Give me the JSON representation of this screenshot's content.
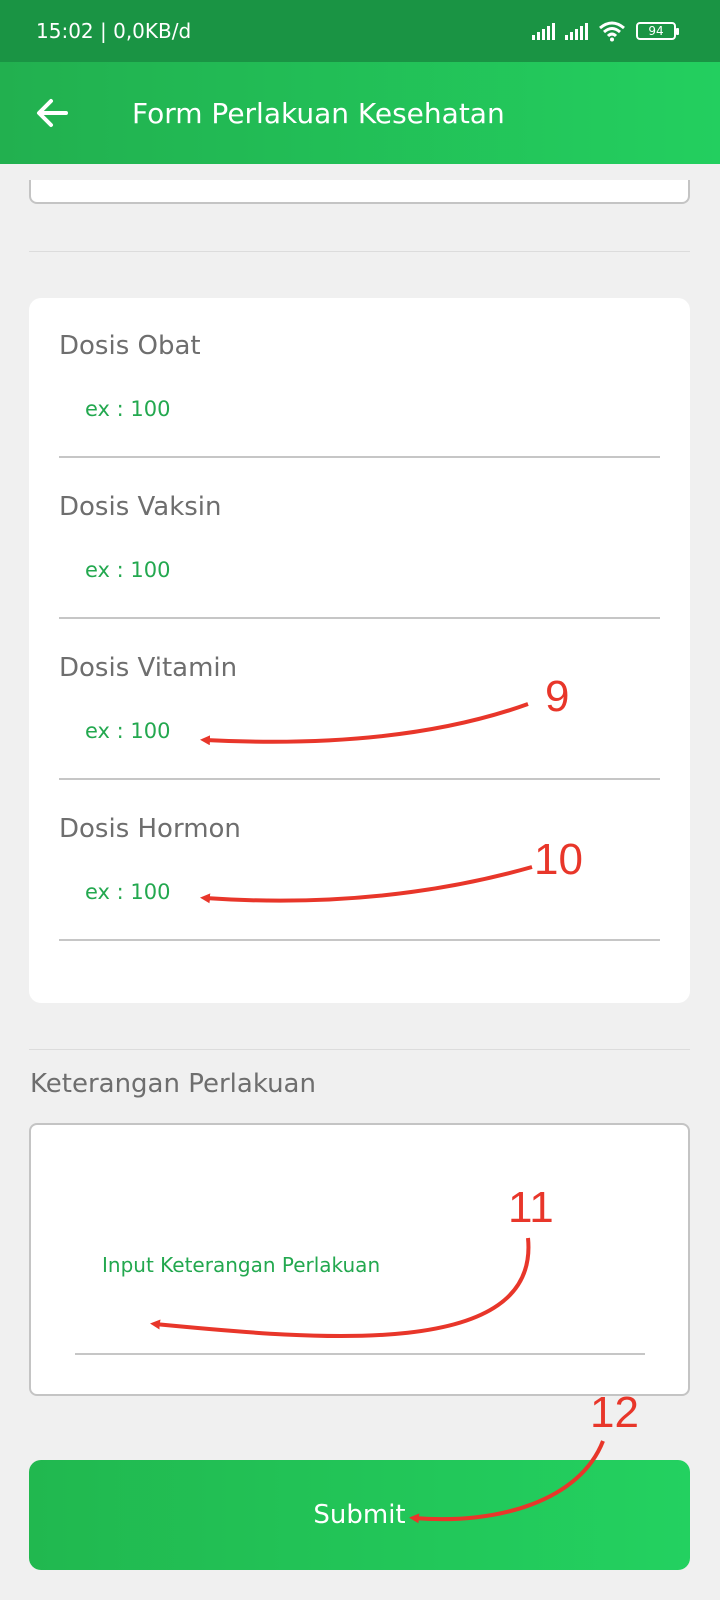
{
  "status_bar": {
    "time_speed": "15:02 | 0,0KB/d",
    "battery": "94"
  },
  "app_bar": {
    "back_icon": "arrow-left-icon",
    "title": "Form Perlakuan Kesehatan"
  },
  "dose_fields": [
    {
      "label": "Dosis Obat",
      "placeholder": "ex : 100"
    },
    {
      "label": "Dosis Vaksin",
      "placeholder": "ex : 100"
    },
    {
      "label": "Dosis Vitamin",
      "placeholder": "ex : 100"
    },
    {
      "label": "Dosis Hormon",
      "placeholder": "ex : 100"
    }
  ],
  "keterangan": {
    "label": "Keterangan Perlakuan",
    "placeholder": "Input Keterangan Perlakuan"
  },
  "submit": {
    "label": "Submit"
  },
  "annotations": [
    "9",
    "10",
    "11",
    "12"
  ],
  "colors": {
    "status_bar": "#1a9444",
    "accent": "#23c85a",
    "placeholder": "#23a84f",
    "annotation": "#e8362a"
  }
}
